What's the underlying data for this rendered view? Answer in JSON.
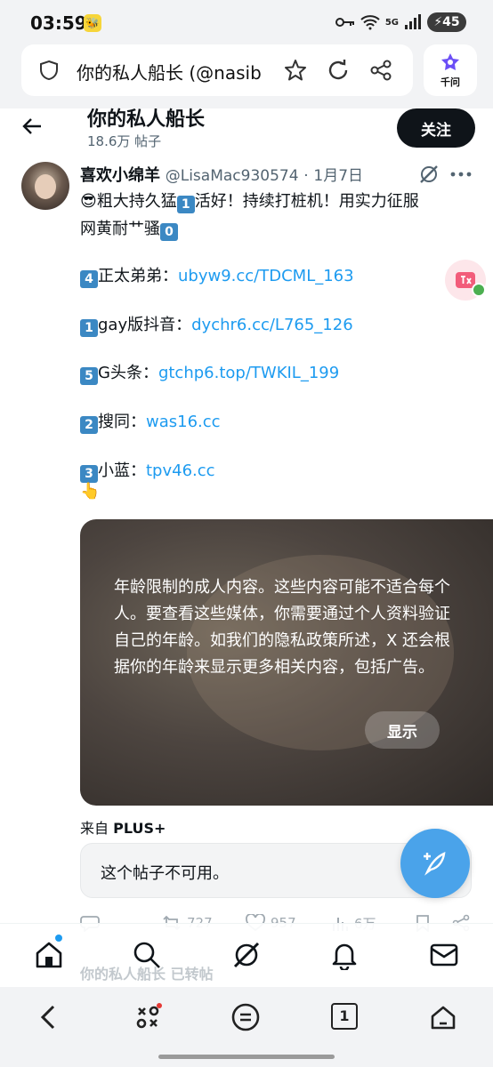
{
  "status_bar": {
    "time": "03:59",
    "battery": "45",
    "network": "5G"
  },
  "browser": {
    "url_text": "你的私人船长 (@nasib",
    "assistant_label": "千问"
  },
  "profile": {
    "name": "你的私人船长",
    "post_count": "18.6万 帖子",
    "follow_label": "关注"
  },
  "tweet": {
    "author_name": "喜欢小绵羊",
    "author_handle": "@LisaMac930574",
    "separator": "·",
    "date": "1月7日",
    "line1_emoji": "😎",
    "line1_text": "粗大持久猛",
    "line1_key": "1",
    "line1_tail": "活好！持续打桩机！用实力征服",
    "line2_text": "网黄耐艹骚",
    "line2_key": "0",
    "links": [
      {
        "key": "4",
        "label": "正太弟弟：",
        "url": "ubyw9.cc/TDCML_163"
      },
      {
        "key": "1",
        "label": "gay版抖音：",
        "url": "dychr6.cc/L765_126"
      },
      {
        "key": "5",
        "label": "G头条：",
        "url": "gtchp6.top/TWKIL_199"
      },
      {
        "key": "2",
        "label": "搜同：",
        "url": "was16.cc"
      },
      {
        "key": "3",
        "label": "小蓝：",
        "url": "tpv46.cc"
      }
    ],
    "pointer_emoji": "👆",
    "media_warning": "年龄限制的成人内容。这些内容可能不适合每个人。要查看这些媒体，你需要通过个人资料验证自己的年龄。如我们的隐私政策所述，X 还会根据你的年龄来显示更多相关内容，包括广告。",
    "show_label": "显示",
    "source_prefix": "来自",
    "source_name": "PLUS+",
    "unavailable": "这个帖子不可用。",
    "stats": {
      "retweets": "727",
      "likes": "957",
      "views": "6万"
    }
  },
  "retweet_notice": "你的私人船长 已转帖",
  "bottom_nav": {
    "tab_count": "1"
  },
  "colors": {
    "accent": "#1d9bf0",
    "fab": "#4aa3ea",
    "follow_bg": "#0f1419"
  },
  "icons": [
    "shield-icon",
    "star-icon",
    "refresh-icon",
    "share-icon",
    "back-arrow-icon",
    "grok-icon",
    "more-icon",
    "translate-icon",
    "compose-icon",
    "home-icon",
    "search-icon",
    "grok-nav-icon",
    "bell-icon",
    "mail-icon"
  ]
}
